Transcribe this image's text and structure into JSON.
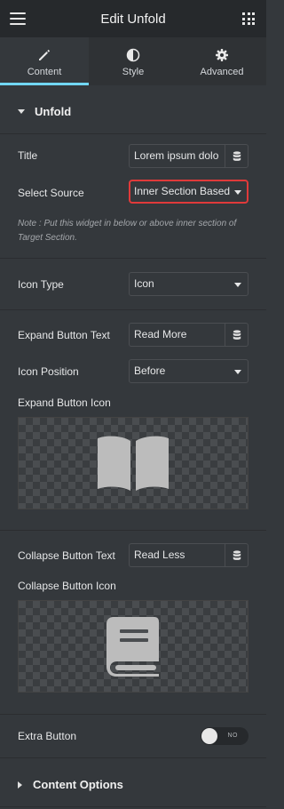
{
  "header": {
    "title": "Edit Unfold",
    "menu_icon": "hamburger-icon",
    "grid_icon": "apps-grid-icon"
  },
  "tabs": [
    {
      "label": "Content",
      "icon": "pencil-icon",
      "active": true
    },
    {
      "label": "Style",
      "icon": "half-circle-icon",
      "active": false
    },
    {
      "label": "Advanced",
      "icon": "gear-icon",
      "active": false
    }
  ],
  "unfold_section": {
    "heading": "Unfold",
    "title_label": "Title",
    "title_value": "Lorem ipsum dolo",
    "source_label": "Select Source",
    "source_value": "Inner Section Based",
    "note": "Note : Put this widget in below or above inner section of Target Section.",
    "icon_type_label": "Icon Type",
    "icon_type_value": "Icon",
    "expand_text_label": "Expand Button Text",
    "expand_text_value": "Read More",
    "icon_position_label": "Icon Position",
    "icon_position_value": "Before",
    "expand_icon_label": "Expand Button Icon",
    "expand_icon": "book-open-icon",
    "collapse_text_label": "Collapse Button Text",
    "collapse_text_value": "Read Less",
    "collapse_icon_label": "Collapse Button Icon",
    "collapse_icon": "book-icon",
    "extra_button_label": "Extra Button",
    "extra_button_state": "NO"
  },
  "content_options": {
    "heading": "Content Options"
  },
  "colors": {
    "accent": "#71d7f7",
    "highlight": "#e03a3a",
    "panel": "#34383c",
    "header": "#26292c"
  }
}
